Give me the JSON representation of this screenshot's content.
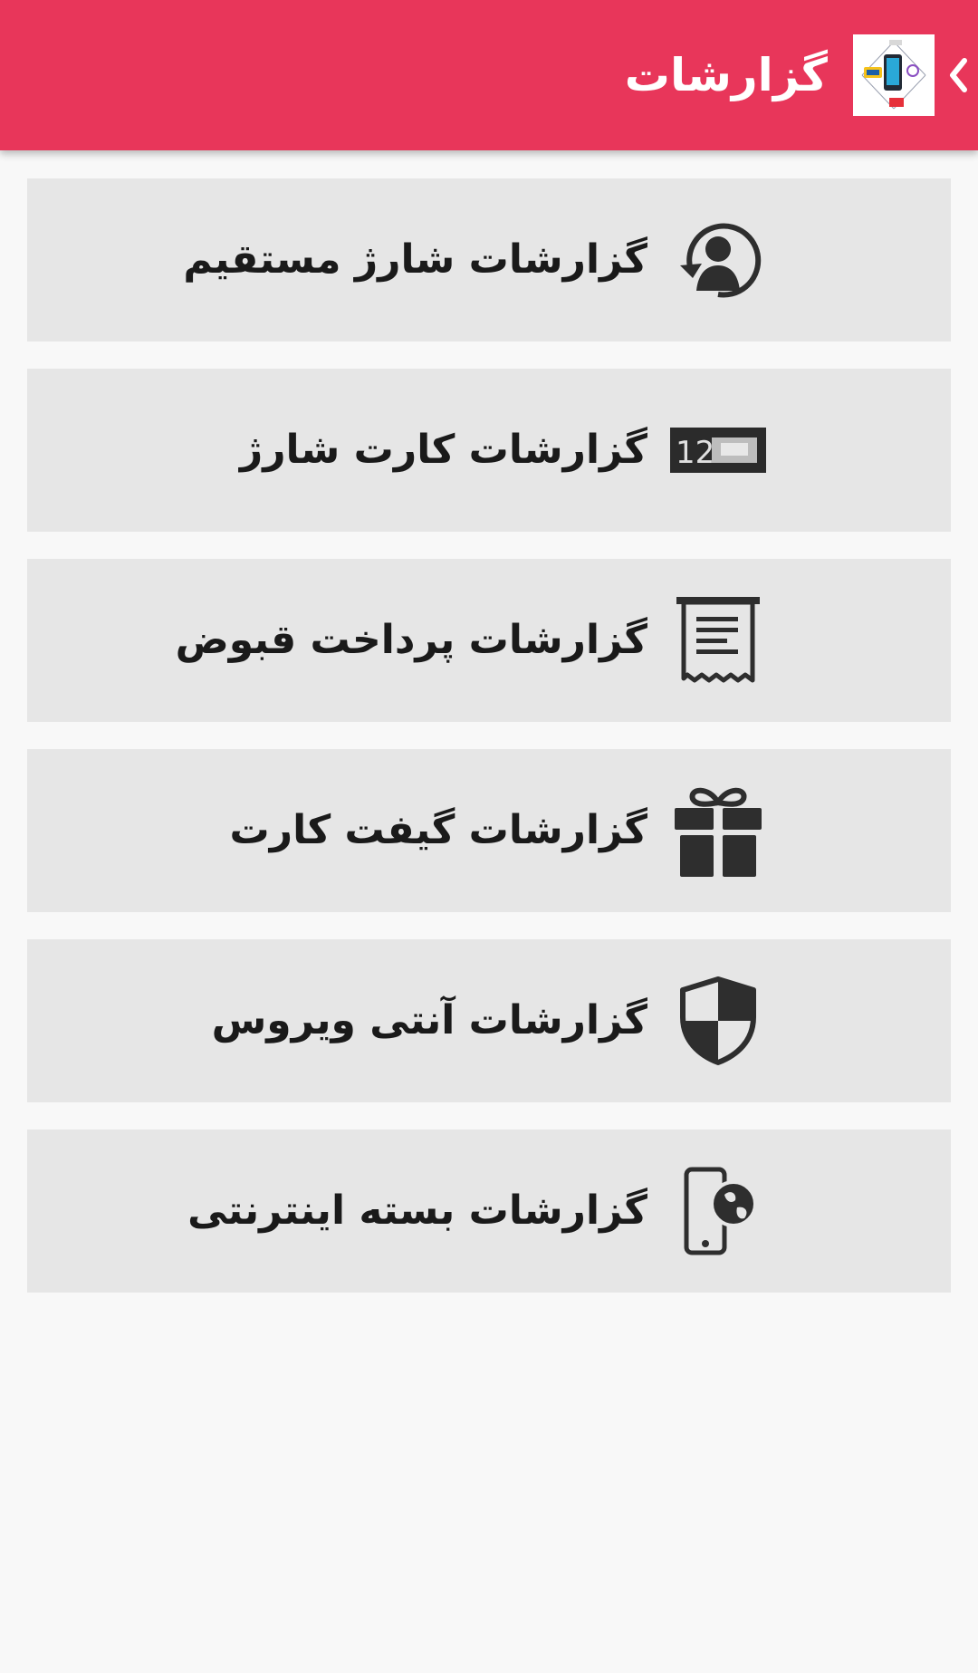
{
  "appbar": {
    "title": "گزارشات",
    "back_icon": "chevron-left-icon",
    "logo_icon": "app-logo-icon",
    "background_color": "#e8365a"
  },
  "menu": {
    "items": [
      {
        "label": "گزارشات شارژ مستقیم",
        "icon": "user-refresh-icon"
      },
      {
        "label": "گزارشات کارت شارژ",
        "icon": "charge-card-icon",
        "card_digits": "12"
      },
      {
        "label": "گزارشات پرداخت قبوض",
        "icon": "receipt-icon"
      },
      {
        "label": "گزارشات گیفت کارت",
        "icon": "gift-icon"
      },
      {
        "label": "گزارشات آنتی ویروس",
        "icon": "shield-icon"
      },
      {
        "label": "گزارشات بسته اینترنتی",
        "icon": "phone-globe-icon"
      }
    ]
  },
  "colors": {
    "accent": "#e8365a",
    "item_background": "#e6e6e6",
    "page_background": "#f8f8f8",
    "icon_color": "#2e2e2e"
  }
}
